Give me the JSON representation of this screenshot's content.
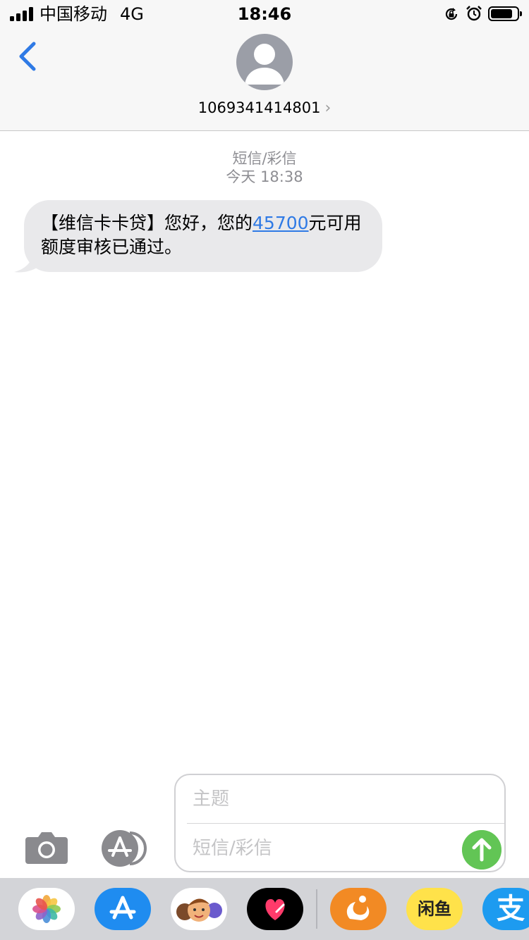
{
  "status_bar": {
    "carrier": "中国移动",
    "network": "4G",
    "time": "18:46"
  },
  "header": {
    "contact_number": "1069341414801",
    "chevron": "›"
  },
  "thread": {
    "service_label": "短信/彩信",
    "timestamp": "今天 18:38",
    "messages": [
      {
        "text_before": "【维信卡卡贷】您好，您的",
        "link_text": "45700",
        "text_after": "元可用额度审核已通过。"
      }
    ]
  },
  "compose": {
    "subject_placeholder": "主题",
    "message_placeholder": "短信/彩信"
  },
  "app_drawer": {
    "apps": [
      {
        "name": "photos-app-icon"
      },
      {
        "name": "app-store-app-icon"
      },
      {
        "name": "memoji-app-icon"
      },
      {
        "name": "digital-touch-app-icon"
      },
      {
        "name": "uc-browser-app-icon"
      },
      {
        "name": "xianyu-app-icon",
        "label": "闲鱼"
      },
      {
        "name": "alipay-app-icon",
        "label": "支"
      }
    ]
  },
  "colors": {
    "accent_blue": "#2f7ae5",
    "send_green": "#62c555",
    "bubble_gray": "#e9e9eb",
    "secondary_text": "#8e8e93"
  }
}
